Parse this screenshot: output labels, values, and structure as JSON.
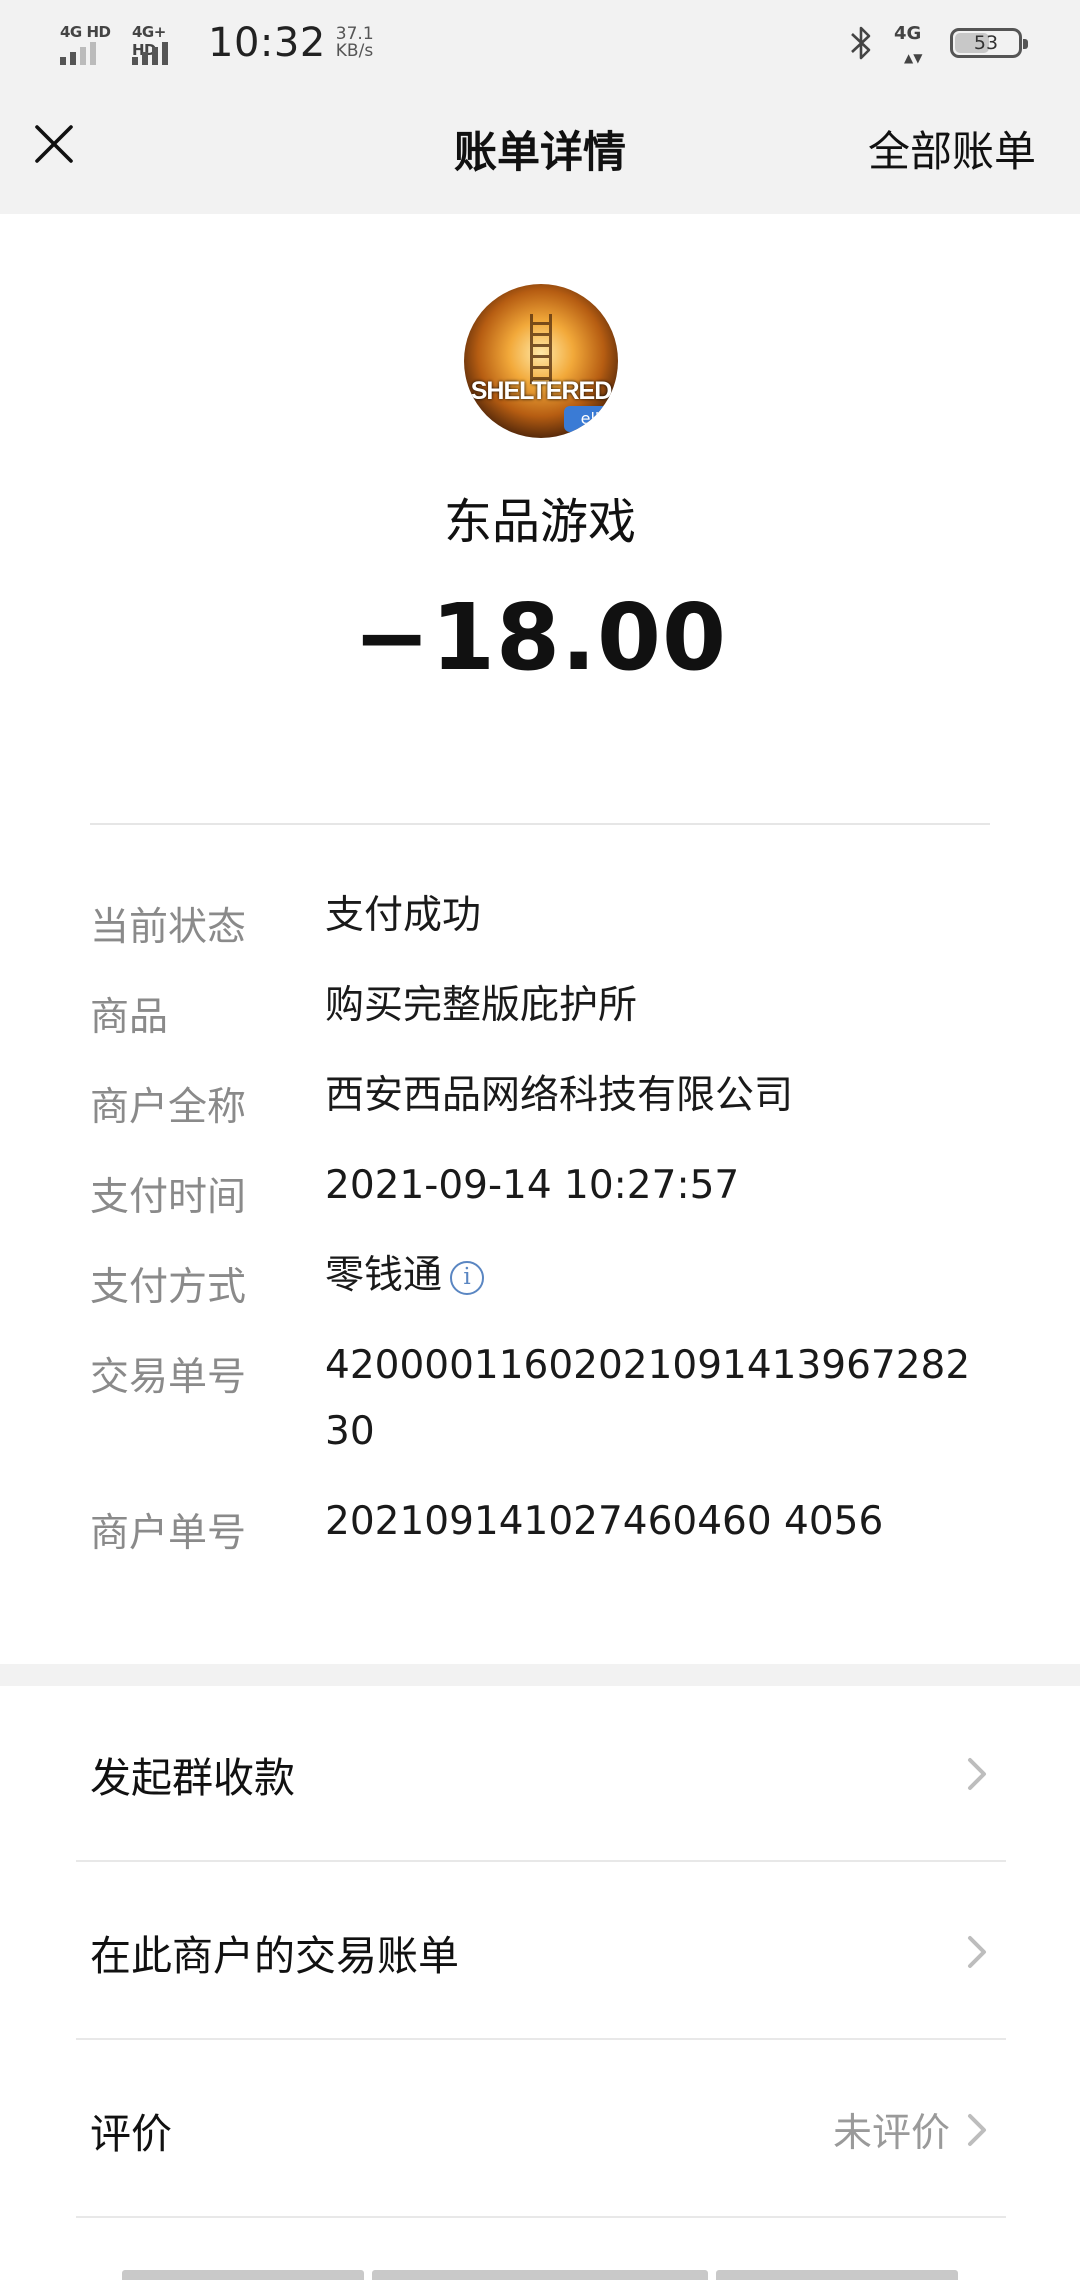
{
  "status_bar": {
    "sim1_network": "4G HD",
    "sim2_network": "4G+ HD",
    "time": "10:32",
    "speed_value": "37.1",
    "speed_unit": "KB/s",
    "cellular_icon_label": "4G",
    "battery_level": "53",
    "icons": [
      "bluetooth-icon",
      "signal-icon",
      "battery-icon"
    ]
  },
  "nav": {
    "close_icon": "close-icon",
    "title": "账单详情",
    "right_action": "全部账单"
  },
  "merchant": {
    "avatar_text": "SHELTERED",
    "avatar_badge": "ell",
    "name": "东品游戏",
    "amount": "−18.00"
  },
  "details": [
    {
      "key": "当前状态",
      "value": "支付成功"
    },
    {
      "key": "商品",
      "value": "购买完整版庇护所"
    },
    {
      "key": "商户全称",
      "value": "西安西品网络科技有限公司"
    },
    {
      "key": "支付时间",
      "value": "2021-09-14 10:27:57"
    },
    {
      "key": "支付方式",
      "value": "零钱通"
    },
    {
      "key": "交易单号",
      "value": "42000011602021091413967282 30"
    },
    {
      "key": "商户单号",
      "value": "202109141027460460 4056"
    }
  ],
  "actions": [
    {
      "label": "发起群收款",
      "hint": ""
    },
    {
      "label": "在此商户的交易账单",
      "hint": ""
    },
    {
      "label": "评价",
      "hint": "未评价"
    }
  ],
  "colors": {
    "header_bg": "#f2f2f2",
    "info_icon": "#5a86c2",
    "muted_text": "#8a8a8a"
  }
}
